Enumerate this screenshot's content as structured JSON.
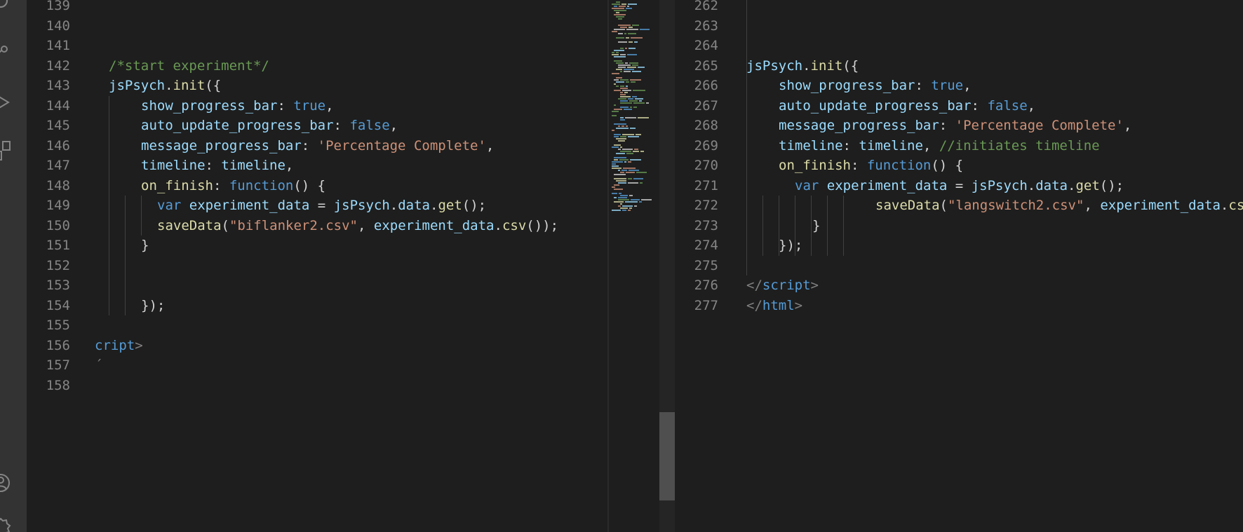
{
  "activity_bar": {
    "icons": [
      "search-icon",
      "source-control-icon",
      "run-debug-icon",
      "extensions-icon",
      "account-icon",
      "settings-gear-icon"
    ]
  },
  "editor_left": {
    "lines": [
      {
        "num": "139",
        "tokens": []
      },
      {
        "num": "140",
        "tokens": []
      },
      {
        "num": "141",
        "tokens": []
      },
      {
        "num": "142",
        "tokens": [
          {
            "t": "/*start experiment*/",
            "c": "comment"
          }
        ]
      },
      {
        "num": "143",
        "tokens": [
          {
            "t": "jsPsych",
            "c": "prop"
          },
          {
            "t": ".",
            "c": "punc"
          },
          {
            "t": "init",
            "c": "func"
          },
          {
            "t": "({",
            "c": "punc"
          }
        ]
      },
      {
        "num": "144",
        "tokens": [
          {
            "t": "show_progress_bar",
            "c": "prop"
          },
          {
            "t": ": ",
            "c": "punc"
          },
          {
            "t": "true",
            "c": "keyword"
          },
          {
            "t": ",",
            "c": "punc"
          }
        ]
      },
      {
        "num": "145",
        "tokens": [
          {
            "t": "auto_update_progress_bar",
            "c": "prop"
          },
          {
            "t": ": ",
            "c": "punc"
          },
          {
            "t": "false",
            "c": "keyword"
          },
          {
            "t": ",",
            "c": "punc"
          }
        ]
      },
      {
        "num": "146",
        "tokens": [
          {
            "t": "message_progress_bar",
            "c": "prop"
          },
          {
            "t": ": ",
            "c": "punc"
          },
          {
            "t": "'Percentage Complete'",
            "c": "string"
          },
          {
            "t": ",",
            "c": "punc"
          }
        ]
      },
      {
        "num": "147",
        "tokens": [
          {
            "t": "timeline",
            "c": "prop"
          },
          {
            "t": ": ",
            "c": "punc"
          },
          {
            "t": "timeline",
            "c": "prop"
          },
          {
            "t": ",",
            "c": "punc"
          }
        ]
      },
      {
        "num": "148",
        "tokens": [
          {
            "t": "on_finish",
            "c": "func"
          },
          {
            "t": ": ",
            "c": "punc"
          },
          {
            "t": "function",
            "c": "keyword"
          },
          {
            "t": "() {",
            "c": "punc"
          }
        ]
      },
      {
        "num": "149",
        "tokens": [
          {
            "t": "var ",
            "c": "keyword"
          },
          {
            "t": "experiment_data",
            "c": "prop"
          },
          {
            "t": " = ",
            "c": "punc"
          },
          {
            "t": "jsPsych",
            "c": "prop"
          },
          {
            "t": ".",
            "c": "punc"
          },
          {
            "t": "data",
            "c": "prop"
          },
          {
            "t": ".",
            "c": "punc"
          },
          {
            "t": "get",
            "c": "func"
          },
          {
            "t": "();",
            "c": "punc"
          }
        ]
      },
      {
        "num": "150",
        "tokens": [
          {
            "t": "saveData",
            "c": "func"
          },
          {
            "t": "(",
            "c": "punc"
          },
          {
            "t": "\"biflanker2.csv\"",
            "c": "string"
          },
          {
            "t": ", ",
            "c": "punc"
          },
          {
            "t": "experiment_data",
            "c": "prop"
          },
          {
            "t": ".",
            "c": "punc"
          },
          {
            "t": "csv",
            "c": "func"
          },
          {
            "t": "());",
            "c": "punc"
          }
        ]
      },
      {
        "num": "151",
        "tokens": [
          {
            "t": "}",
            "c": "punc"
          }
        ]
      },
      {
        "num": "152",
        "tokens": []
      },
      {
        "num": "153",
        "tokens": []
      },
      {
        "num": "154",
        "tokens": [
          {
            "t": "});",
            "c": "punc"
          }
        ]
      },
      {
        "num": "155",
        "tokens": []
      },
      {
        "num": "156",
        "tokens": [
          {
            "t": "cript",
            "c": "tag"
          },
          {
            "t": ">",
            "c": "tagpunc"
          }
        ]
      },
      {
        "num": "157",
        "tokens": [
          {
            "t": "´",
            "c": "tagpunc"
          }
        ]
      },
      {
        "num": "158",
        "tokens": []
      }
    ]
  },
  "editor_right": {
    "lines": [
      {
        "num": "262",
        "tokens": []
      },
      {
        "num": "263",
        "tokens": []
      },
      {
        "num": "264",
        "tokens": []
      },
      {
        "num": "265",
        "tokens": [
          {
            "t": "jsPsych",
            "c": "prop"
          },
          {
            "t": ".",
            "c": "punc"
          },
          {
            "t": "init",
            "c": "func"
          },
          {
            "t": "({",
            "c": "punc"
          }
        ]
      },
      {
        "num": "266",
        "tokens": [
          {
            "t": "show_progress_bar",
            "c": "prop"
          },
          {
            "t": ": ",
            "c": "punc"
          },
          {
            "t": "true",
            "c": "keyword"
          },
          {
            "t": ",",
            "c": "punc"
          }
        ]
      },
      {
        "num": "267",
        "tokens": [
          {
            "t": "auto_update_progress_bar",
            "c": "prop"
          },
          {
            "t": ": ",
            "c": "punc"
          },
          {
            "t": "false",
            "c": "keyword"
          },
          {
            "t": ",",
            "c": "punc"
          }
        ]
      },
      {
        "num": "268",
        "tokens": [
          {
            "t": "message_progress_bar",
            "c": "prop"
          },
          {
            "t": ": ",
            "c": "punc"
          },
          {
            "t": "'Percentage Complete'",
            "c": "string"
          },
          {
            "t": ",",
            "c": "punc"
          }
        ]
      },
      {
        "num": "269",
        "tokens": [
          {
            "t": "timeline",
            "c": "prop"
          },
          {
            "t": ": ",
            "c": "punc"
          },
          {
            "t": "timeline",
            "c": "prop"
          },
          {
            "t": ", ",
            "c": "punc"
          },
          {
            "t": "//initiates timeline",
            "c": "comment"
          }
        ]
      },
      {
        "num": "270",
        "tokens": [
          {
            "t": "on_finish",
            "c": "func"
          },
          {
            "t": ": ",
            "c": "punc"
          },
          {
            "t": "function",
            "c": "keyword"
          },
          {
            "t": "() {",
            "c": "punc"
          }
        ]
      },
      {
        "num": "271",
        "tokens": [
          {
            "t": "var ",
            "c": "keyword"
          },
          {
            "t": "experiment_data",
            "c": "prop"
          },
          {
            "t": " = ",
            "c": "punc"
          },
          {
            "t": "jsPsych",
            "c": "prop"
          },
          {
            "t": ".",
            "c": "punc"
          },
          {
            "t": "data",
            "c": "prop"
          },
          {
            "t": ".",
            "c": "punc"
          },
          {
            "t": "get",
            "c": "func"
          },
          {
            "t": "();",
            "c": "punc"
          }
        ]
      },
      {
        "num": "272",
        "tokens": [
          {
            "t": "saveData",
            "c": "func"
          },
          {
            "t": "(",
            "c": "punc"
          },
          {
            "t": "\"langswitch2.csv\"",
            "c": "string"
          },
          {
            "t": ", ",
            "c": "punc"
          },
          {
            "t": "experiment_data",
            "c": "prop"
          },
          {
            "t": ".",
            "c": "punc"
          },
          {
            "t": "csv",
            "c": "func"
          }
        ]
      },
      {
        "num": "273",
        "tokens": [
          {
            "t": "}",
            "c": "punc"
          }
        ]
      },
      {
        "num": "274",
        "tokens": [
          {
            "t": "});",
            "c": "punc"
          }
        ]
      },
      {
        "num": "275",
        "tokens": []
      },
      {
        "num": "276",
        "tokens": [
          {
            "t": "</",
            "c": "tagpunc"
          },
          {
            "t": "script",
            "c": "tag"
          },
          {
            "t": ">",
            "c": "tagpunc"
          }
        ]
      },
      {
        "num": "277",
        "tokens": [
          {
            "t": "</",
            "c": "tagpunc"
          },
          {
            "t": "html",
            "c": "tag"
          },
          {
            "t": ">",
            "c": "tagpunc"
          }
        ]
      }
    ]
  },
  "colors": {
    "comment": "#6a9955",
    "keyword": "#569cd6",
    "string": "#ce9178",
    "func": "#dcdcaa",
    "prop": "#9cdcfe",
    "punc": "#d4d4d4",
    "tag": "#569cd6",
    "tagpunc": "#808080"
  }
}
